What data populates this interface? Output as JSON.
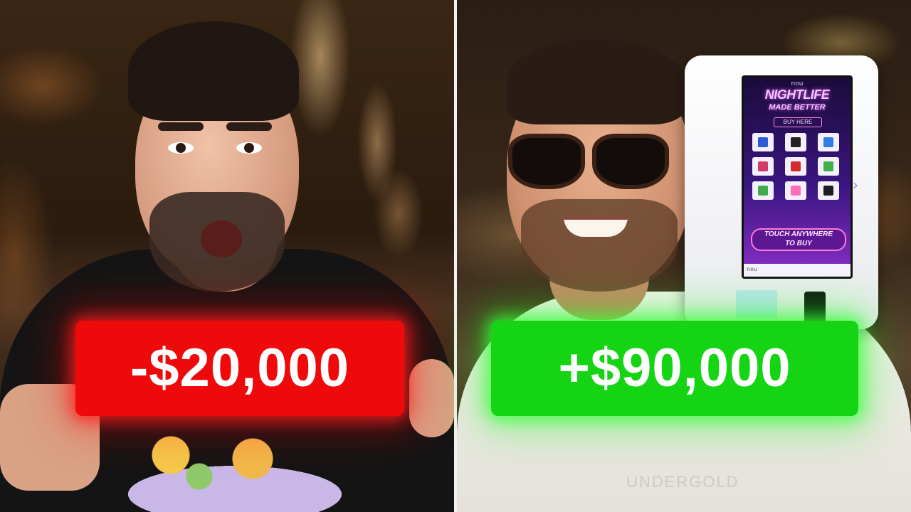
{
  "left_panel": {
    "amount": "-$20,000",
    "amount_color": "#ee0a0a"
  },
  "right_panel": {
    "amount": "+$90,000",
    "amount_color": "#14d414",
    "shirt_text": "UNDERGOLD",
    "kiosk": {
      "logo": "nou",
      "title": "NIGHTLIFE",
      "subtitle": "MADE BETTER",
      "buy_label": "BUY HERE",
      "touch_label_line1": "TOUCH ANYWHERE",
      "touch_label_line2": "TO BUY",
      "footer_logo": "nou",
      "arrow_icon": "chevron-right-icon"
    }
  }
}
